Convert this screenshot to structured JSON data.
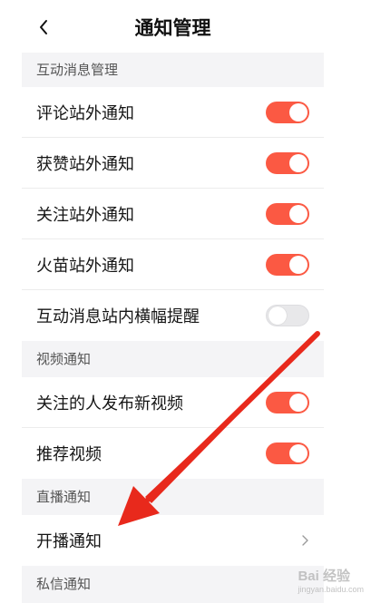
{
  "header": {
    "title": "通知管理"
  },
  "sections": {
    "interaction": "互动消息管理",
    "video": "视频通知",
    "live": "直播通知",
    "dm": "私信通知"
  },
  "rows": {
    "comment": {
      "label": "评论站外通知",
      "enabled": true
    },
    "like": {
      "label": "获赞站外通知",
      "enabled": true
    },
    "follow": {
      "label": "关注站外通知",
      "enabled": true
    },
    "flame": {
      "label": "火苗站外通知",
      "enabled": true
    },
    "banner": {
      "label": "互动消息站内横幅提醒",
      "enabled": false
    },
    "followed_new_video": {
      "label": "关注的人发布新视频",
      "enabled": true
    },
    "recommended_video": {
      "label": "推荐视频",
      "enabled": true
    },
    "live_start": {
      "label": "开播通知"
    }
  },
  "colors": {
    "toggle_on": "#fb5943",
    "toggle_off": "#e8e8ea",
    "section_bg": "#f4f4f6",
    "arrow": "#e8291c"
  },
  "watermark": {
    "text": "Bai 经验",
    "url": "jingyan.baidu.com"
  }
}
